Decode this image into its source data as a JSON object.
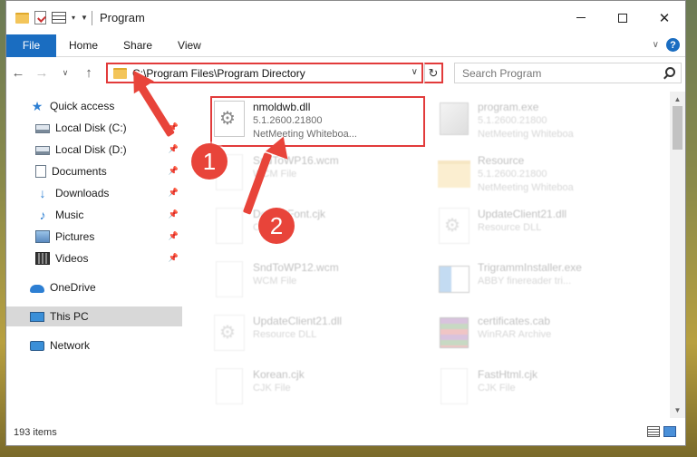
{
  "window": {
    "title": "Program",
    "controls": {
      "minimize": "minimize",
      "maximize": "maximize",
      "close": "✕"
    }
  },
  "ribbon": {
    "tabs": [
      "File",
      "Home",
      "Share",
      "View"
    ],
    "help": "?"
  },
  "address": {
    "path": "C:\\Program Files\\Program Directory"
  },
  "search": {
    "placeholder": "Search Program"
  },
  "sidebar": {
    "items": [
      {
        "label": "Quick access",
        "icon": "star-icon"
      },
      {
        "label": "Local Disk (C:)",
        "icon": "disk-icon"
      },
      {
        "label": "Local Disk (D:)",
        "icon": "disk-icon"
      },
      {
        "label": "Documents",
        "icon": "documents-icon"
      },
      {
        "label": "Downloads",
        "icon": "downloads-icon"
      },
      {
        "label": "Music",
        "icon": "music-icon"
      },
      {
        "label": "Pictures",
        "icon": "pictures-icon"
      },
      {
        "label": "Videos",
        "icon": "videos-icon"
      },
      {
        "label": "OneDrive",
        "icon": "onedrive-icon"
      },
      {
        "label": "This PC",
        "icon": "this-pc-icon"
      },
      {
        "label": "Network",
        "icon": "network-icon"
      }
    ]
  },
  "files": [
    {
      "name": "nmoldwb.dll",
      "line2": "5.1.2600.21800",
      "line3": "NetMeeting Whiteboa...",
      "icon": "dll-gear-icon"
    },
    {
      "name": "program.exe",
      "line2": "5.1.2600.21800",
      "line3": "NetMeeting Whiteboa",
      "icon": "exe-icon"
    },
    {
      "name": "SndToWP16.wcm",
      "line2": "WCM File",
      "icon": "blank-file-icon"
    },
    {
      "name": "Resource",
      "line2": "5.1.2600.21800",
      "line3": "NetMeeting Whiteboa",
      "icon": "folder-icon"
    },
    {
      "name": "DefaultFont.cjk",
      "line2": "CJK File",
      "icon": "blank-file-icon"
    },
    {
      "name": "UpdateClient21.dll",
      "line2": "Resource DLL",
      "icon": "dll-gear-icon"
    },
    {
      "name": "SndToWP12.wcm",
      "line2": "WCM File",
      "icon": "blank-file-icon"
    },
    {
      "name": "TrigrammInstaller.exe",
      "line2": "ABBY finereader tri...",
      "icon": "installer-icon"
    },
    {
      "name": "UpdateClient21.dll",
      "line2": "Resource DLL",
      "icon": "dll-gear-icon"
    },
    {
      "name": "certificates.cab",
      "line2": "WinRAR Archive",
      "icon": "winrar-icon"
    },
    {
      "name": "Korean.cjk",
      "line2": "CJK File",
      "icon": "blank-file-icon"
    },
    {
      "name": "FastHtml.cjk",
      "line2": "CJK File",
      "icon": "blank-file-icon"
    }
  ],
  "status": {
    "item_count": "193 items"
  },
  "annotations": {
    "step1": "1",
    "step2": "2"
  },
  "colors": {
    "accent": "#1a6dc1",
    "highlight": "#e23b3b",
    "arrow": "#e8443a"
  }
}
